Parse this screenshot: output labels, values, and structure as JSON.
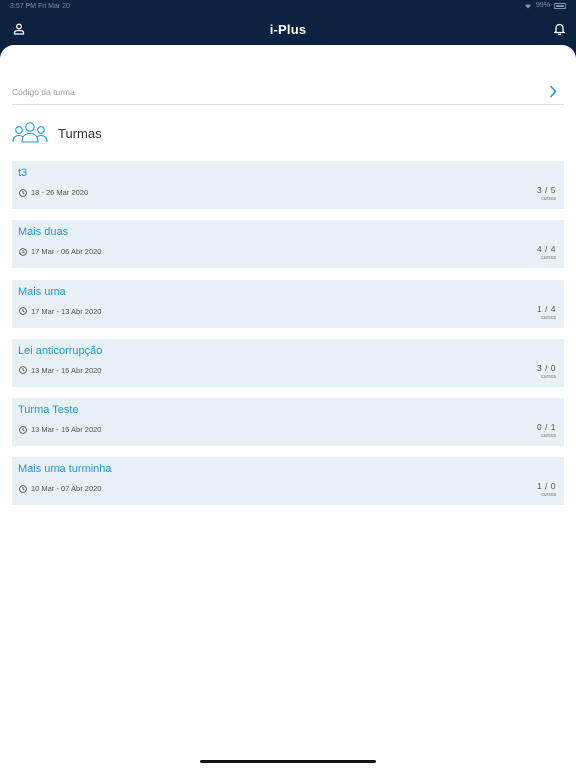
{
  "status_bar": {
    "time": "3:57 PM",
    "date": "Fri Mar 20",
    "battery": "99%"
  },
  "header": {
    "title": "i-Plus"
  },
  "code_field": {
    "placeholder": "Código da turma"
  },
  "section": {
    "title": "Turmas"
  },
  "classes": [
    {
      "name": "t3",
      "dates": "18 - 26 Mar 2020",
      "count": "3 / 5",
      "unit": "cursos"
    },
    {
      "name": "Mais duas",
      "dates": "17 Mar - 06 Abr 2020",
      "count": "4 / 4",
      "unit": "cursos"
    },
    {
      "name": "Mais uma",
      "dates": "17 Mar - 13 Abr 2020",
      "count": "1 / 4",
      "unit": "cursos"
    },
    {
      "name": "Lei anticorrupção",
      "dates": "13 Mar - 15 Abr 2020",
      "count": "3 / 0",
      "unit": "cursos"
    },
    {
      "name": "Turma Teste",
      "dates": "13 Mar - 15 Abr 2020",
      "count": "0 / 1",
      "unit": "cursos"
    },
    {
      "name": "Mais uma turminha",
      "dates": "10 Mar - 07 Abr 2020",
      "count": "1 / 0",
      "unit": "cursos"
    }
  ],
  "colors": {
    "nav_bg": "#0b2140",
    "accent": "#1a9bd7",
    "card_bg": "#e8f1f5"
  },
  "icons": {
    "profile": "person-icon",
    "bell": "bell-icon",
    "go": "chevron-right-icon",
    "group": "group-icon",
    "clock": "clock-icon"
  }
}
